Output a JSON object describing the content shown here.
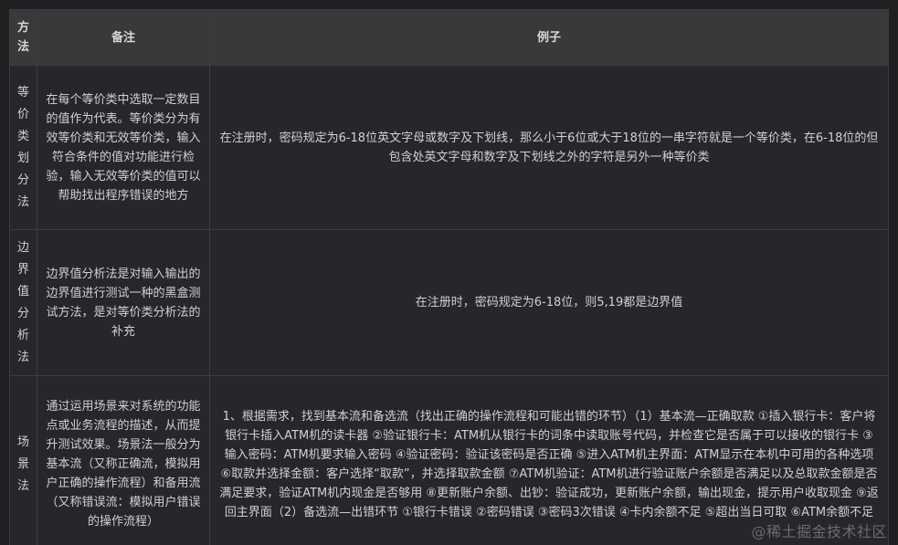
{
  "table": {
    "headers": [
      "方法",
      "备注",
      "例子"
    ],
    "rows": [
      {
        "method": "等价类划分法",
        "note": "在每个等价类中选取一定数目的值作为代表。等价类分为有效等价类和无效等价类，输入符合条件的值对功能进行检验，输入无效等价类的值可以帮助找出程序错误的地方",
        "example": "在注册时，密码规定为6-18位英文字母或数字及下划线，那么小于6位或大于18位的一串字符就是一个等价类，在6-18位的但包含处英文字母和数字及下划线之外的字符是另外一种等价类"
      },
      {
        "method": "边界值分析法",
        "note": "边界值分析法是对输入输出的边界值进行测试一种的黑盒测试方法，是对等价类分析法的补充",
        "example": "在注册时，密码规定为6-18位，则5,19都是边界值"
      },
      {
        "method": "场景法",
        "note": "通过运用场景来对系统的功能点或业务流程的描述，从而提升测试效果。场景法一般分为基本流（又称正确流，模拟用户正确的操作流程）和备用流（又称错误流：模拟用户错误的操作流程）",
        "example": "1、根据需求，找到基本流和备选流（找出正确的操作流程和可能出错的环节）（1）基本流—正确取款 ①插入银行卡：客户将银行卡插入ATM机的读卡器 ②验证银行卡：ATM机从银行卡的词条中读取账号代码，并检查它是否属于可以接收的银行卡 ③输入密码：ATM机要求输入密码 ④验证密码：验证该密码是否正确 ⑤进入ATM机主界面：ATM显示在本机中可用的各种选项 ⑥取款并选择金额：客户选择“取款”，并选择取款金额 ⑦ATM机验证：ATM机进行验证账户余额是否满足以及总取款金额是否满足要求，验证ATM机内现金是否够用 ⑧更新账户余额、出钞：验证成功，更新账户余额，输出现金，提示用户收取现金 ⑨返回主界面（2）备选流—出错环节 ①银行卡错误 ②密码错误 ③密码3次错误 ④卡内余额不足 ⑤超出当日可取 ⑥ATM余额不足"
      }
    ]
  },
  "watermark": "@稀土掘金技术社区",
  "colors": {
    "background": "#1f2022",
    "header_bg": "#38393b",
    "cell_bg": "#26272a",
    "border": "#3b3d41",
    "text": "#cfd1d4",
    "watermark": "#6a6c70"
  }
}
